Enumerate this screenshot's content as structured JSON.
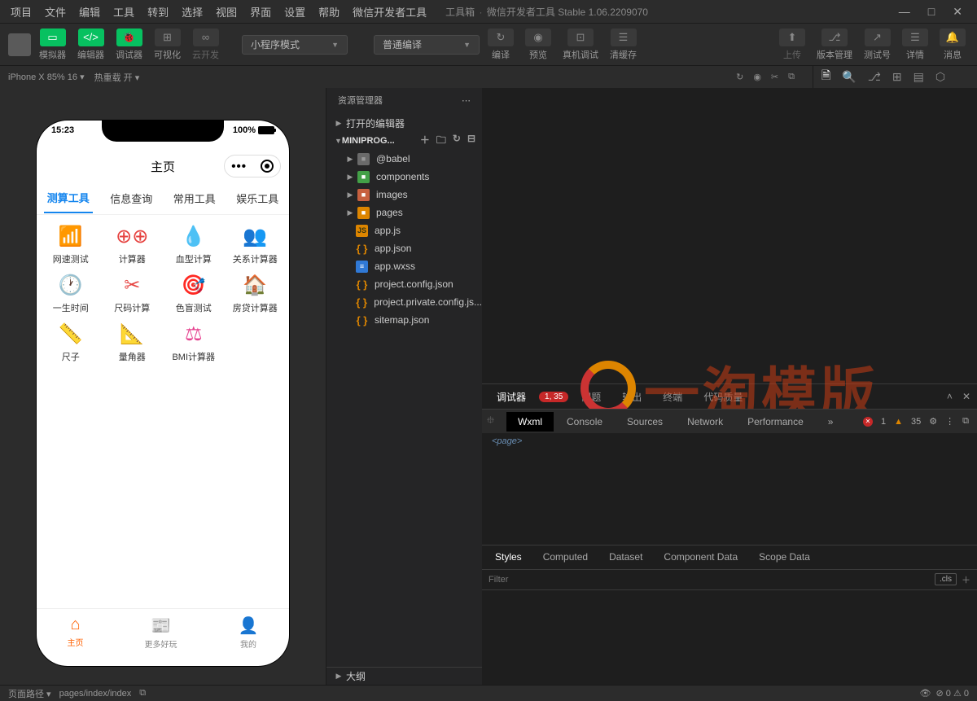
{
  "menu": [
    "项目",
    "文件",
    "编辑",
    "工具",
    "转到",
    "选择",
    "视图",
    "界面",
    "设置",
    "帮助",
    "微信开发者工具"
  ],
  "title_pre": "工具箱",
  "title_post": "微信开发者工具 Stable 1.06.2209070",
  "toolbar": {
    "simulator": "模拟器",
    "editor": "编辑器",
    "debugger": "调试器",
    "visualize": "可视化",
    "cloud": "云开发",
    "mode": "小程序模式",
    "compile_mode": "普通编译",
    "compile": "编译",
    "preview": "预览",
    "remote": "真机调试",
    "cache": "清缓存",
    "upload": "上传",
    "version": "版本管理",
    "test": "测试号",
    "detail": "详情",
    "message": "消息"
  },
  "device": {
    "name": "iPhone X 85% 16",
    "reload": "热重载 开"
  },
  "explorer": {
    "title": "资源管理器",
    "open_editors": "打开的编辑器",
    "project": "MINIPROG...",
    "outline": "大纲"
  },
  "files": {
    "babel": "@babel",
    "components": "components",
    "images": "images",
    "pages": "pages",
    "appjs": "app.js",
    "appjson": "app.json",
    "appwxss": "app.wxss",
    "projconf": "project.config.json",
    "projpriv": "project.private.config.js...",
    "sitemap": "sitemap.json"
  },
  "phone": {
    "time": "15:23",
    "battery": "100%",
    "title": "主页",
    "tabs": [
      "测算工具",
      "信息查询",
      "常用工具",
      "娱乐工具"
    ],
    "grid": [
      "网速测试",
      "计算器",
      "血型计算",
      "关系计算器",
      "一生时间",
      "尺码计算",
      "色盲测试",
      "房贷计算器",
      "尺子",
      "量角器",
      "BMI计算器"
    ],
    "tabbar": [
      "主页",
      "更多好玩",
      "我的"
    ]
  },
  "watermark": "一淘模版",
  "dbg": {
    "tab": "调试器",
    "badge": "1, 35",
    "problems": "问题",
    "output": "输出",
    "terminal": "终端",
    "quality": "代码质量",
    "err": "1",
    "warn": "35",
    "page": "<page>"
  },
  "dev": {
    "wxml": "Wxml",
    "console": "Console",
    "sources": "Sources",
    "network": "Network",
    "performance": "Performance"
  },
  "style": {
    "styles": "Styles",
    "computed": "Computed",
    "dataset": "Dataset",
    "compdata": "Component Data",
    "scopedata": "Scope Data",
    "filter": "Filter",
    "cls": ".cls"
  },
  "status": {
    "pagepath": "页面路径",
    "path": "pages/index/index",
    "counts": "0",
    "warns": "0"
  }
}
